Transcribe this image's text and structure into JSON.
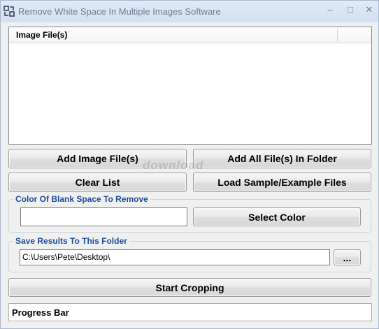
{
  "window": {
    "title": "Remove White Space In Multiple Images Software",
    "minimize_glyph": "–",
    "maximize_glyph": "□",
    "close_glyph": "✕"
  },
  "file_list": {
    "column_header": "Image File(s)",
    "items": []
  },
  "buttons": {
    "add_image_files": "Add Image File(s)",
    "add_all_files_in_folder": "Add All File(s) In Folder",
    "clear_list": "Clear List",
    "load_sample_files": "Load Sample/Example Files",
    "select_color": "Select Color",
    "browse": "...",
    "start_cropping": "Start Cropping"
  },
  "color_group": {
    "label": "Color Of Blank Space To Remove",
    "color_value": "",
    "swatch_color": "#ffffff"
  },
  "save_group": {
    "label": "Save Results To This Folder",
    "folder_path": "C:\\Users\\Pete\\Desktop\\"
  },
  "progress": {
    "label": "Progress Bar",
    "value": 0
  },
  "watermark": {
    "text": "download"
  },
  "colors": {
    "group_label": "#1c4e9c",
    "titlebar": "#d2dff0"
  }
}
